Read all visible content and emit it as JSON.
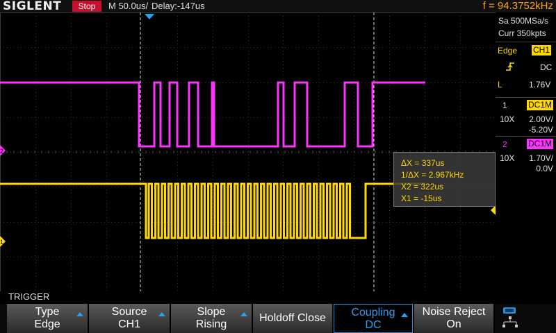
{
  "header": {
    "logo": "SIGLENT",
    "status": "Stop",
    "timebase": "M 50.0us/",
    "delay": "Delay:-147us",
    "frequency": "f = 94.3752kHz"
  },
  "acquisition": {
    "sample_rate": "Sa 500MSa/s",
    "memory": "Curr 350kpts"
  },
  "trigger_panel": {
    "type": "Edge",
    "source_badge": "CH1",
    "coupling": "DC",
    "mode": "L",
    "level": "1.76V"
  },
  "channels": [
    {
      "index": "1",
      "badge": "DC1M",
      "probe": "10X",
      "scale": "2.00V/",
      "offset": "-5.20V",
      "color": "#ffd800"
    },
    {
      "index": "2",
      "badge": "DC1M",
      "probe": "10X",
      "scale": "1.70V/",
      "offset": "0.0V",
      "color": "#ff33ff"
    }
  ],
  "markers": {
    "ch1": "1",
    "ch2": "2"
  },
  "cursors": {
    "delta_x": "ΔX = 337us",
    "inv_delta_x": "1/ΔX = 2.967kHz",
    "x2": "X2 = 322us",
    "x1": "X1 = -15us"
  },
  "menu": {
    "title": "TRIGGER",
    "softkeys": [
      {
        "top": "Type",
        "bottom": "Edge"
      },
      {
        "top": "Source",
        "bottom": "CH1"
      },
      {
        "top": "Slope",
        "bottom": "Rising"
      },
      {
        "top": "Holdoff Close",
        "bottom": ""
      },
      {
        "top": "Coupling",
        "bottom": "DC"
      },
      {
        "top": "Noise Reject",
        "bottom": "On"
      }
    ]
  },
  "colors": {
    "ch1": "#ffd800",
    "ch2": "#ff33ff",
    "accent": "#2aa0f0",
    "status": "#c8102e"
  }
}
